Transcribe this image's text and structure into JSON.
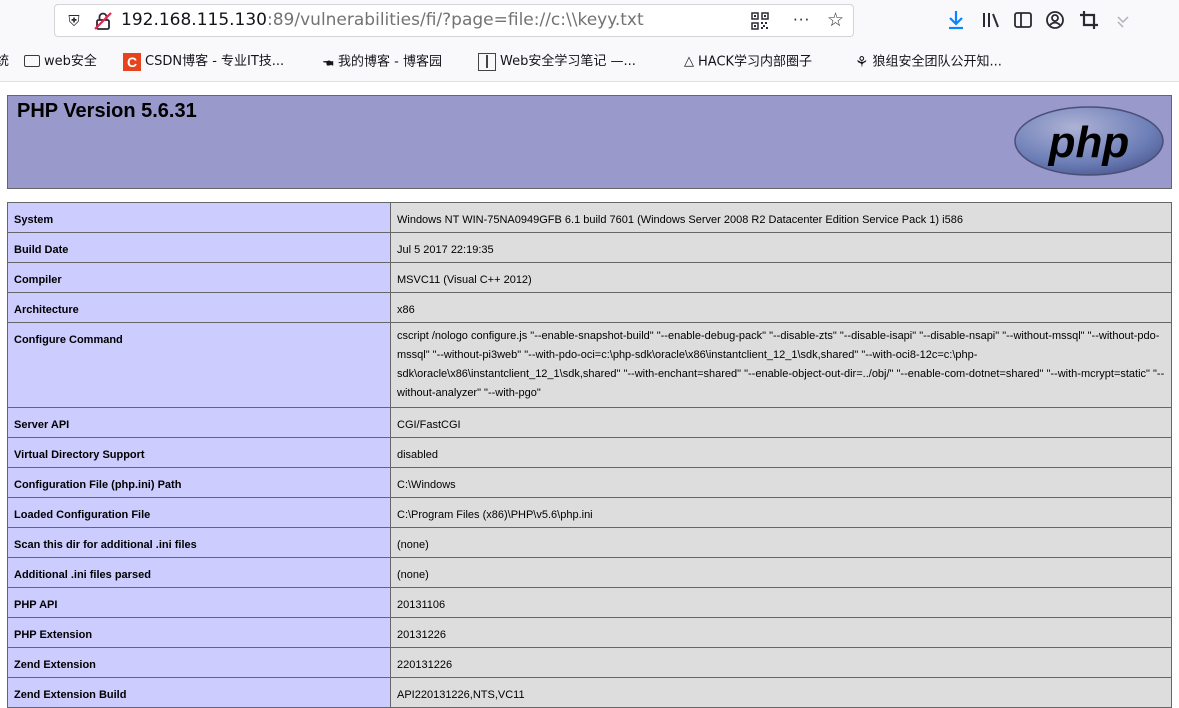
{
  "browser": {
    "url_host": "192.168.115.130",
    "url_rest": ":89/vulnerabilities/fi/?page=file://c:\\\\keyy.txt",
    "menu_dots": "···",
    "star": "☆"
  },
  "bookmarks": [
    {
      "label": "统"
    },
    {
      "label": "web安全"
    },
    {
      "label": "CSDN博客 - 专业IT技..."
    },
    {
      "label": "我的博客 - 博客园"
    },
    {
      "label": "Web安全学习笔记 —..."
    },
    {
      "label": "HACK学习内部圈子"
    },
    {
      "label": "狼组安全团队公开知..."
    }
  ],
  "phpinfo": {
    "title": "PHP Version 5.6.31",
    "logo_text": "php",
    "rows": [
      {
        "key": "System",
        "value": "Windows NT WIN-75NA0949GFB 6.1 build 7601 (Windows Server 2008 R2 Datacenter Edition Service Pack 1) i586"
      },
      {
        "key": "Build Date",
        "value": "Jul 5 2017 22:19:35"
      },
      {
        "key": "Compiler",
        "value": "MSVC11 (Visual C++ 2012)"
      },
      {
        "key": "Architecture",
        "value": "x86"
      },
      {
        "key": "Configure Command",
        "value": "cscript /nologo configure.js \"--enable-snapshot-build\" \"--enable-debug-pack\" \"--disable-zts\" \"--disable-isapi\" \"--disable-nsapi\" \"--without-mssql\" \"--without-pdo-mssql\" \"--without-pi3web\" \"--with-pdo-oci=c:\\php-sdk\\oracle\\x86\\instantclient_12_1\\sdk,shared\" \"--with-oci8-12c=c:\\php-sdk\\oracle\\x86\\instantclient_12_1\\sdk,shared\" \"--with-enchant=shared\" \"--enable-object-out-dir=../obj/\" \"--enable-com-dotnet=shared\" \"--with-mcrypt=static\" \"--without-analyzer\" \"--with-pgo\""
      },
      {
        "key": "Server API",
        "value": "CGI/FastCGI"
      },
      {
        "key": "Virtual Directory Support",
        "value": "disabled"
      },
      {
        "key": "Configuration File (php.ini) Path",
        "value": "C:\\Windows"
      },
      {
        "key": "Loaded Configuration File",
        "value": "C:\\Program Files (x86)\\PHP\\v5.6\\php.ini"
      },
      {
        "key": "Scan this dir for additional .ini files",
        "value": "(none)"
      },
      {
        "key": "Additional .ini files parsed",
        "value": "(none)"
      },
      {
        "key": "PHP API",
        "value": "20131106"
      },
      {
        "key": "PHP Extension",
        "value": "20131226"
      },
      {
        "key": "Zend Extension",
        "value": "220131226"
      },
      {
        "key": "Zend Extension Build",
        "value": "API220131226,NTS,VC11"
      }
    ]
  }
}
